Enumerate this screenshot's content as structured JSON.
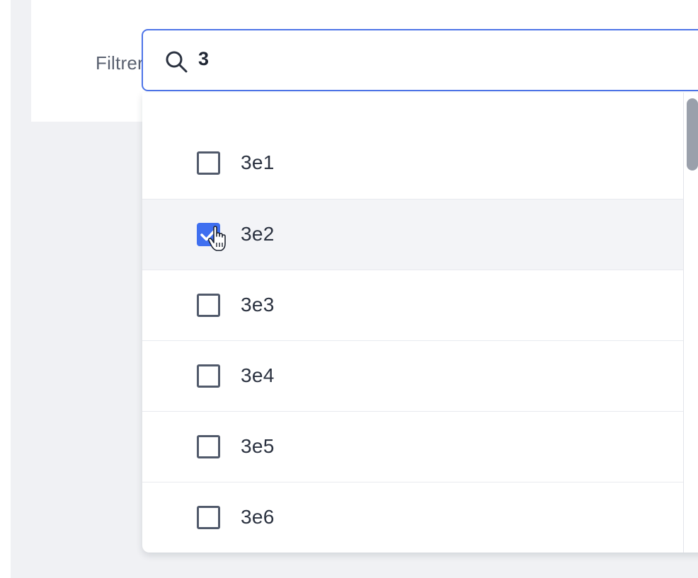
{
  "filter": {
    "label": "Filtrer",
    "search_value": "3",
    "search_icon": "search-icon"
  },
  "options": [
    {
      "label": "3e1",
      "checked": false
    },
    {
      "label": "3e2",
      "checked": true
    },
    {
      "label": "3e3",
      "checked": false
    },
    {
      "label": "3e4",
      "checked": false
    },
    {
      "label": "3e5",
      "checked": false
    },
    {
      "label": "3e6",
      "checked": false
    }
  ],
  "colors": {
    "accent": "#3f6ff0",
    "input_border": "#4d74e8",
    "text": "#2b3240",
    "backdrop": "#f0f1f4"
  }
}
